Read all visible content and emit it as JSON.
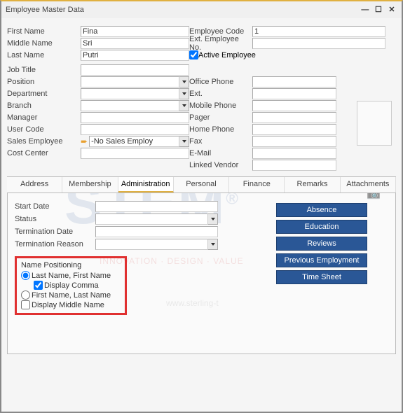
{
  "window": {
    "title": "Employee Master Data"
  },
  "left": {
    "first_name_lbl": "First Name",
    "first_name": "Fina",
    "middle_name_lbl": "Middle Name",
    "middle_name": "Sri",
    "last_name_lbl": "Last Name",
    "last_name": "Putri",
    "job_title_lbl": "Job Title",
    "job_title": "",
    "position_lbl": "Position",
    "position": "",
    "department_lbl": "Department",
    "department": "",
    "branch_lbl": "Branch",
    "branch": "",
    "manager_lbl": "Manager",
    "manager": "",
    "user_code_lbl": "User Code",
    "user_code": "",
    "sales_emp_lbl": "Sales Employee",
    "sales_emp": "-No Sales Employ",
    "cost_center_lbl": "Cost Center",
    "cost_center": ""
  },
  "right": {
    "emp_code_lbl": "Employee Code",
    "emp_code": "1",
    "ext_emp_no_lbl": "Ext. Employee No.",
    "ext_emp_no": "",
    "active_emp_lbl": "Active Employee",
    "office_phone_lbl": "Office Phone",
    "office_phone": "",
    "ext_lbl": "Ext.",
    "ext": "",
    "mobile_lbl": "Mobile Phone",
    "mobile": "",
    "pager_lbl": "Pager",
    "pager": "",
    "home_phone_lbl": "Home Phone",
    "home_phone": "",
    "fax_lbl": "Fax",
    "fax": "",
    "email_lbl": "E-Mail",
    "email": "",
    "linked_vendor_lbl": "Linked Vendor",
    "linked_vendor": ""
  },
  "tabs": [
    "Address",
    "Membership",
    "Administration",
    "Personal",
    "Finance",
    "Remarks",
    "Attachments"
  ],
  "admin": {
    "start_date_lbl": "Start Date",
    "start_date": "",
    "status_lbl": "Status",
    "status": "",
    "term_date_lbl": "Termination Date",
    "term_date": "",
    "term_reason_lbl": "Termination Reason",
    "term_reason": "",
    "namepos_title": "Name Positioning",
    "opt_last_first": "Last Name, First Name",
    "opt_display_comma": "Display Comma",
    "opt_first_last": "First Name, Last Name",
    "opt_display_middle": "Display Middle Name"
  },
  "buttons": {
    "absence": "Absence",
    "education": "Education",
    "reviews": "Reviews",
    "prev_emp": "Previous Employment",
    "timesheet": "Time Sheet"
  }
}
